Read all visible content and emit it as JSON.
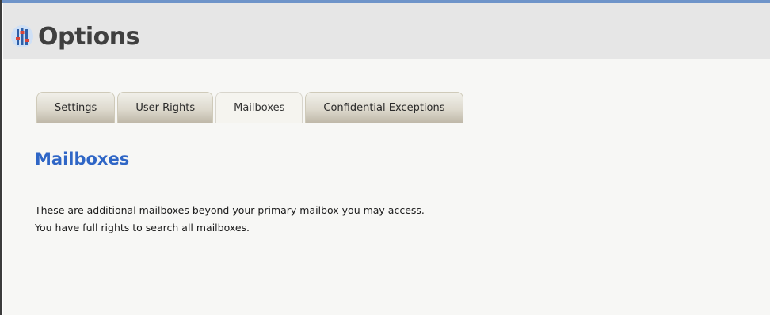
{
  "header": {
    "title": "Options",
    "icon": "options-sliders-icon"
  },
  "tabs": [
    {
      "label": "Settings",
      "active": false
    },
    {
      "label": "User Rights",
      "active": false
    },
    {
      "label": "Mailboxes",
      "active": true
    },
    {
      "label": "Confidential Exceptions",
      "active": false
    }
  ],
  "section": {
    "title": "Mailboxes",
    "lines": [
      "These are additional mailboxes beyond your primary mailbox you may access.",
      "You have full rights to search all mailboxes."
    ]
  },
  "colors": {
    "accent_blue": "#2f66c6",
    "top_border": "#6f94c9",
    "header_bg": "#e6e6e6"
  }
}
